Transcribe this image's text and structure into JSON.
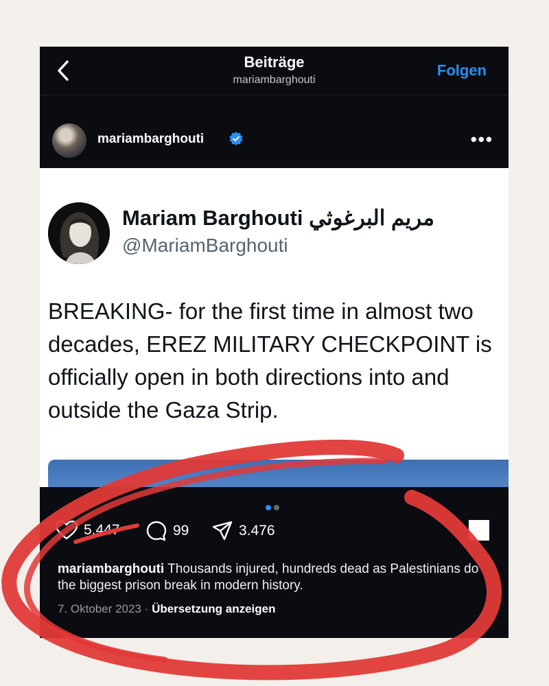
{
  "nav": {
    "title": "Beiträge",
    "subtitle": "mariambarghouti",
    "follow_label": "Folgen"
  },
  "post": {
    "username": "mariambarghouti",
    "verified": true,
    "more_label": "•••"
  },
  "tweet": {
    "display_name": "Mariam Barghouti مريم البرغوثي",
    "handle": "@MariamBarghouti",
    "text": "BREAKING- for the first time in almost two decades, EREZ MILITARY CHECKPOINT is officially open in both directions into and outside the Gaza Strip."
  },
  "carousel": {
    "count": 2,
    "active": 1
  },
  "actions": {
    "likes": "5.447",
    "comments": "99",
    "shares": "3.476"
  },
  "caption": {
    "username": "mariambarghouti",
    "text": "Thousands injured, hundreds dead as Palestinians do the biggest prison break in modern history."
  },
  "meta": {
    "date": "7. Oktober 2023",
    "separator": "·",
    "translate_label": "Übersetzung anzeigen"
  },
  "colors": {
    "accent": "#2b8ff0",
    "background": "#0a0c11",
    "annotation": "#e03a38"
  },
  "icons": [
    "back-chevron-icon",
    "verified-badge-icon",
    "more-icon",
    "heart-icon",
    "comment-icon",
    "share-icon",
    "bookmark-icon"
  ]
}
